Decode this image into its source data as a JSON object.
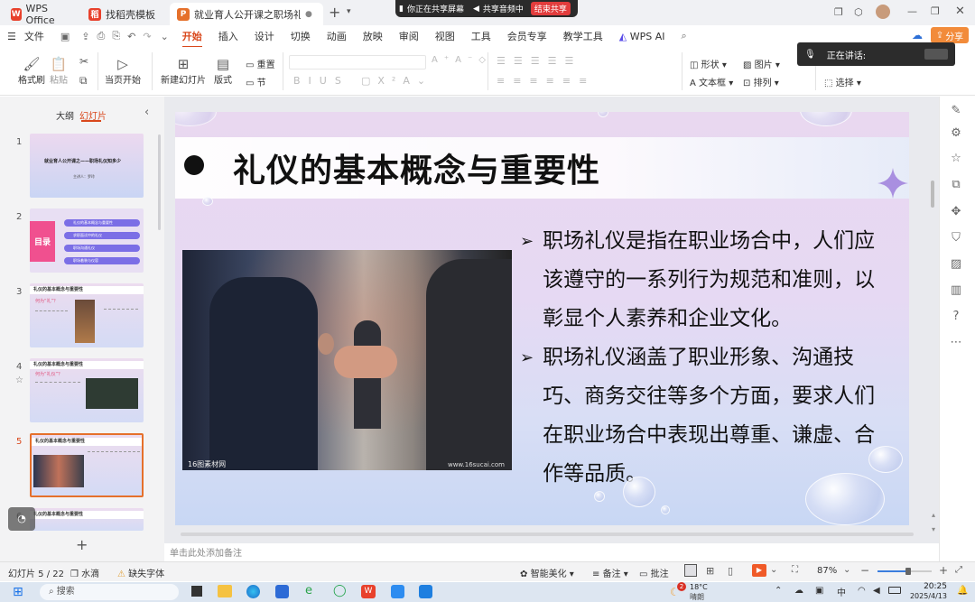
{
  "share_bar": {
    "screen": "你正在共享屏幕",
    "audio": "共享音频中",
    "stop": "结束共享"
  },
  "tabs": [
    {
      "label": "WPS Office"
    },
    {
      "label": "找稻壳模板"
    },
    {
      "label": "就业育人公开课之职场礼仪知"
    }
  ],
  "menu": {
    "file": "文件",
    "items": [
      "开始",
      "插入",
      "设计",
      "切换",
      "动画",
      "放映",
      "审阅",
      "视图",
      "工具",
      "会员专享",
      "教学工具",
      "WPS AI"
    ],
    "share": "分享"
  },
  "speaking": "正在讲话:",
  "ribbon": {
    "format_painter": "格式刷",
    "paste": "粘贴",
    "from_start": "当页开始",
    "new_slide": "新建幻灯片",
    "layout": "版式",
    "reset": "重置",
    "section": "节",
    "shape": "形状",
    "picture": "图片",
    "textbox": "文本框",
    "arrange": "排列",
    "select": "选择"
  },
  "left_pane": {
    "outline": "大纲",
    "slides": "幻灯片"
  },
  "thumbs": [
    {
      "num": "1",
      "title": "就业育人公开课之——职场礼仪知多少",
      "sub": "主讲人：罗玲"
    },
    {
      "num": "2",
      "title": "目录",
      "items": [
        "礼仪的基本概念与重要性",
        "求职面试中的礼仪",
        "职场沟通礼仪",
        "职场着装与仪容"
      ]
    },
    {
      "num": "3",
      "title": "礼仪的基本概念与重要性",
      "sub": "何为“礼”？"
    },
    {
      "num": "4",
      "title": "礼仪的基本概念与重要性",
      "sub": "何为“礼仪”？"
    },
    {
      "num": "5",
      "title": "礼仪的基本概念与重要性"
    },
    {
      "num": "6",
      "title": "礼仪的基本概念与重要性"
    }
  ],
  "slide": {
    "title": "礼仪的基本概念与重要性",
    "bullets": [
      "职场礼仪是指在职业场合中，人们应该遵守的一系列行为规范和准则，以彰显个人素养和企业文化。",
      "职场礼仪涵盖了职业形象、沟通技巧、商务交往等多个方面，要求人们在职业场合中表现出尊重、谦虚、合作等品质。"
    ],
    "watermark_left": "16图素材网",
    "watermark_right": "www.16sucai.com"
  },
  "notes_placeholder": "单击此处添加备注",
  "status": {
    "slide_count": "幻灯片 5 / 22",
    "theme": "水滴",
    "missing_font": "缺失字体",
    "smart": "智能美化",
    "notes": "备注",
    "comments": "批注",
    "zoom": "87%"
  },
  "taskbar": {
    "search": "搜索",
    "weather_temp": "18°C",
    "weather_text": "晴朗",
    "weather_badge": "2",
    "ime": "中",
    "time": "20:25",
    "date": "2025/4/13"
  },
  "colors": {
    "accent": "#d9481c",
    "share_btn": "#f28b3a",
    "stop_btn": "#e23d3d",
    "sharebar": "#2b2b2b"
  }
}
